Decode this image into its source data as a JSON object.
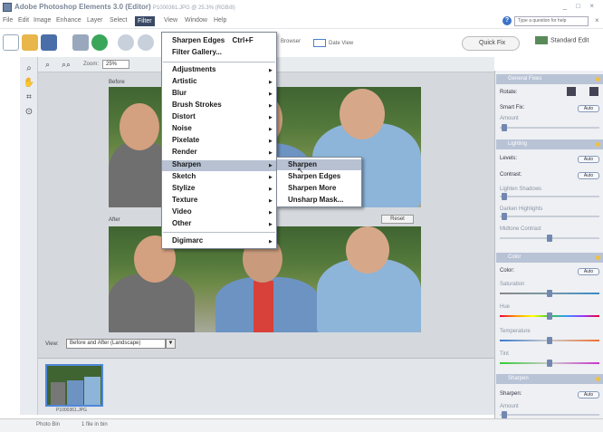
{
  "window": {
    "title": "Adobe Photoshop Elements 3.0 (Editor)",
    "document": "P1000361.JPG @ 25.3% (RGB/8)",
    "controls": "_ □ ×"
  },
  "menubar": {
    "items": [
      "File",
      "Edit",
      "Image",
      "Enhance",
      "Layer",
      "Select",
      "Filter",
      "View",
      "Window",
      "Help"
    ],
    "active": "Filter"
  },
  "help": {
    "placeholder": "Type a question for help"
  },
  "toolbar": {
    "browser_label": "Browser",
    "date_view_label": "Date View",
    "quick_fix_label": "Quick Fix",
    "standard_edit_label": "Standard Edit"
  },
  "zoom": {
    "label": "Zoom:",
    "value": "25%"
  },
  "canvas": {
    "before_label": "Before",
    "after_label": "After",
    "reset_label": "Reset",
    "view_label": "View:",
    "view_value": "Before and After (Landscape)"
  },
  "photo_bin": {
    "thumb_label": "P1000361.JPG"
  },
  "status": {
    "photo_bin": "Photo Bin",
    "count": "1 file in bin"
  },
  "filter_menu": {
    "top": [
      {
        "label": "Sharpen Edges",
        "shortcut": "Ctrl+F"
      },
      {
        "label": "Filter Gallery..."
      }
    ],
    "groups": [
      "Adjustments",
      "Artistic",
      "Blur",
      "Brush Strokes",
      "Distort",
      "Noise",
      "Pixelate",
      "Render",
      "Sharpen",
      "Sketch",
      "Stylize",
      "Texture",
      "Video",
      "Other"
    ],
    "bottom": [
      "Digimarc"
    ],
    "highlighted": "Sharpen"
  },
  "sharpen_submenu": {
    "items": [
      "Sharpen",
      "Sharpen Edges",
      "Sharpen More",
      "Unsharp Mask..."
    ],
    "highlighted": "Sharpen"
  },
  "palette": {
    "general": {
      "header": "General Fixes",
      "rotate_label": "Rotate:",
      "smart_fix_label": "Smart Fix:",
      "auto_label": "Auto",
      "amount_label": "Amount"
    },
    "lighting": {
      "header": "Lighting",
      "levels_label": "Levels:",
      "contrast_label": "Contrast:",
      "auto_label": "Auto",
      "shadows_label": "Lighten Shadows",
      "highlights_label": "Darken Highlights",
      "midtone_label": "Midtone Contrast"
    },
    "color": {
      "header": "Color",
      "color_label": "Color:",
      "auto_label": "Auto",
      "saturation_label": "Saturation",
      "hue_label": "Hue",
      "temperature_label": "Temperature",
      "tint_label": "Tint"
    },
    "sharpen": {
      "header": "Sharpen",
      "sharpen_label": "Sharpen:",
      "auto_label": "Auto",
      "amount_label": "Amount"
    }
  }
}
